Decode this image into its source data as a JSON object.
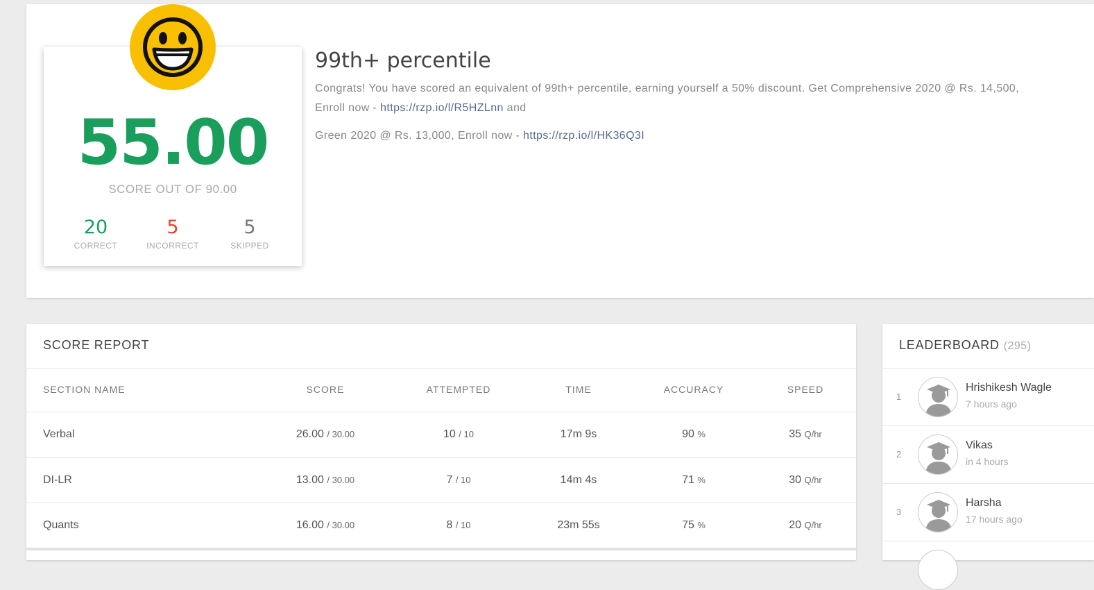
{
  "summary": {
    "score": "55.00",
    "score_out_label": "SCORE OUT OF 90.00",
    "correct": {
      "value": "20",
      "label": "CORRECT",
      "color": "#1a9e5c"
    },
    "incorrect": {
      "value": "5",
      "label": "INCORRECT",
      "color": "#e0452e"
    },
    "skipped": {
      "value": "5",
      "label": "SKIPPED",
      "color": "#777777"
    },
    "percentile_title": "99th+ percentile",
    "congrats_line1": "Congrats! You have scored an equivalent of 99th+ percentile, earning yourself a 50% discount. Get Comprehensive 2020 @ Rs. 14,500,",
    "enroll_prefix": "Enroll now - ",
    "link1": "https://rzp.io/l/R5HZLnn",
    "and_text": " and",
    "green_prefix": "Green 2020 @ Rs. 13,000, Enroll now - ",
    "link2": "https://rzp.io/l/HK36Q3I",
    "icon": "smiley-icon"
  },
  "score_report": {
    "title": "SCORE REPORT",
    "headers": [
      "SECTION NAME",
      "SCORE",
      "ATTEMPTED",
      "TIME",
      "ACCURACY",
      "SPEED"
    ],
    "rows": [
      {
        "section": "Verbal",
        "score": "26.00",
        "score_max": "/ 30.00",
        "attempted": "10",
        "attempted_max": "/ 10",
        "time": "17m 9s",
        "accuracy": "90",
        "accuracy_unit": "%",
        "speed": "35",
        "speed_unit": "Q/hr"
      },
      {
        "section": "DI-LR",
        "score": "13.00",
        "score_max": "/ 30.00",
        "attempted": "7",
        "attempted_max": "/ 10",
        "time": "14m 4s",
        "accuracy": "71",
        "accuracy_unit": "%",
        "speed": "30",
        "speed_unit": "Q/hr"
      },
      {
        "section": "Quants",
        "score": "16.00",
        "score_max": "/ 30.00",
        "attempted": "8",
        "attempted_max": "/ 10",
        "time": "23m 55s",
        "accuracy": "75",
        "accuracy_unit": "%",
        "speed": "20",
        "speed_unit": "Q/hr"
      }
    ]
  },
  "leaderboard": {
    "title": "LEADERBOARD",
    "count": "(295)",
    "entries": [
      {
        "rank": "1",
        "name": "Hrishikesh Wagle",
        "time": "7 hours ago"
      },
      {
        "rank": "2",
        "name": "Vikas",
        "time": "in 4 hours"
      },
      {
        "rank": "3",
        "name": "Harsha",
        "time": "17 hours ago"
      }
    ]
  }
}
